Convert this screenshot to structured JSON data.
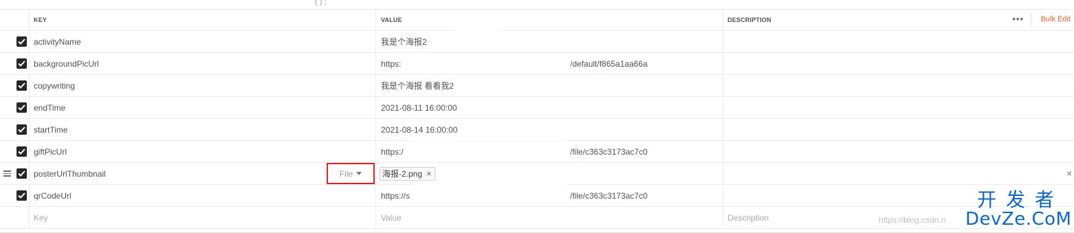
{
  "top_mark": "( ) ;",
  "headers": {
    "key": "KEY",
    "value": "VALUE",
    "description": "DESCRIPTION",
    "more": "•••",
    "bulk_edit": "Bulk Edit"
  },
  "rows": [
    {
      "key": "activityName",
      "value": "我是个海报2"
    },
    {
      "key": "backgroundPicUrl",
      "value": "https:",
      "value_tail": "/default/f865a1aa66a"
    },
    {
      "key": "copywriting",
      "value": "我是个海报  看看我2"
    },
    {
      "key": "endTime",
      "value": "2021-08-11 16:00:00"
    },
    {
      "key": "startTime",
      "value": "2021-08-14 16:00:00"
    },
    {
      "key": "giftPicUrl",
      "value": "https:/",
      "value_tail": "/file/c363c3173ac7c0"
    },
    {
      "key": "posterUrlThumbnail",
      "type_label": "File",
      "file_name": "海报-2.png",
      "remove": "×",
      "row_remove": "×"
    },
    {
      "key": "qrCodeUrl",
      "value": "https://s",
      "value_tail": "/file/c363c3173ac7c0"
    }
  ],
  "new_row": {
    "key_placeholder": "Key",
    "value_placeholder": "Value",
    "description_placeholder": "Description"
  },
  "watermark": {
    "top": "开发者",
    "bottom": "DevZe.CoM",
    "url": "https://blog.csdn.n"
  }
}
